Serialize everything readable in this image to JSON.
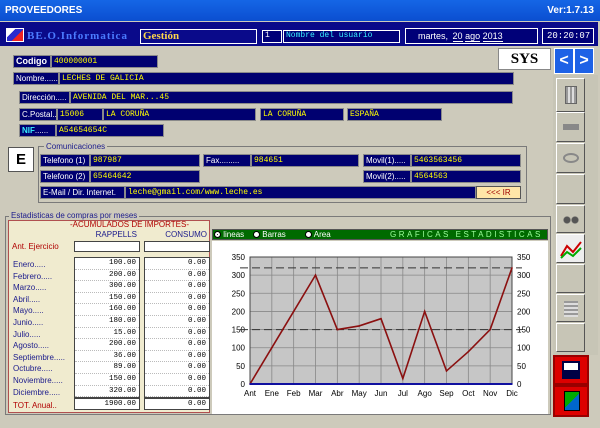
{
  "window": {
    "title": "PROVEEDORES",
    "version": "Ver:1.7.13"
  },
  "topbar": {
    "company": "BE.O.Informatica",
    "module": "Gestión",
    "user_num": "1",
    "user_name": "Nombre del usuario",
    "date_dow": "martes,",
    "date_day": "20",
    "date_mon": "ago",
    "date_year": "2013",
    "time": "20:20:07"
  },
  "buttons": {
    "sys": "SYS",
    "prev": "<",
    "next": ">",
    "e": "E",
    "ir": "<<< IR"
  },
  "form": {
    "codigo_label": "Codigo",
    "codigo": "400000001",
    "nombre_label": "Nombre",
    "nombre": "LECHES DE GALICIA",
    "direccion_label": "Dirección",
    "direccion": "AVENIDA DEL MAR...45",
    "cp_label": "C.Postal",
    "cp": "15006",
    "poblacion": "LA CORUÑA",
    "provincia": "LA CORUÑA",
    "pais": "ESPAÑA",
    "nif_label": "NIF",
    "nif": "A54654654C"
  },
  "comunicaciones": {
    "title": "Comunicaciones",
    "tel1_label": "Telefono (1)",
    "tel1": "987987",
    "fax_label": "Fax",
    "fax": "984651",
    "movil1_label": "Movil(1)",
    "movil1": "5463563456",
    "tel2_label": "Telefono (2)",
    "tel2": "65464642",
    "movil2_label": "Movil(2)",
    "movil2": "4564563",
    "email_label": "E-Mail / Dir. Internet",
    "email": "leche@gmail.com/www.leche.es"
  },
  "stats": {
    "title": "Estadisticas de compras por meses",
    "acum_title": "ACUMULADOS DE IMPORTES",
    "col_rappells": "RAPPELLS",
    "col_consumo": "CONSUMO",
    "ant_label": "Ant. Ejercicio",
    "months": [
      "Enero",
      "Febrero",
      "Marzo",
      "Abril",
      "Mayo",
      "Junio",
      "Julio",
      "Agosto",
      "Septiembre",
      "Octubre",
      "Noviembre",
      "Diciembre"
    ],
    "rappells": [
      "100.00",
      "200.00",
      "300.00",
      "150.00",
      "160.00",
      "180.00",
      "15.00",
      "200.00",
      "36.00",
      "89.00",
      "150.00",
      "320.00"
    ],
    "consumo": [
      "0.00",
      "0.00",
      "0.00",
      "0.00",
      "0.00",
      "0.00",
      "0.00",
      "0.00",
      "0.00",
      "0.00",
      "0.00",
      "0.00"
    ],
    "total_label": "TOT. Anual",
    "total_rappells": "1900.00",
    "total_consumo": "0.00"
  },
  "graph": {
    "opt_lineas": "lineas",
    "opt_barras": "Barras",
    "opt_area": "Area",
    "title": "GRAFICAS ESTADISTICAS",
    "selected": "lineas"
  },
  "chart_data": {
    "type": "line",
    "categories": [
      "Ant",
      "Ene",
      "Feb",
      "Mar",
      "Abr",
      "May",
      "Jun",
      "Jul",
      "Ago",
      "Sep",
      "Oct",
      "Nov",
      "Dic"
    ],
    "series": [
      {
        "values": [
          0,
          100,
          200,
          300,
          150,
          160,
          180,
          15,
          200,
          36,
          89,
          150,
          320
        ],
        "color": "#8b1010"
      },
      {
        "values": [
          0,
          0,
          0,
          0,
          0,
          0,
          0,
          0,
          0,
          0,
          0,
          0,
          0
        ],
        "color": "#1010a0"
      }
    ],
    "ylim": [
      0,
      350
    ],
    "yticks": [
      0,
      50,
      100,
      150,
      200,
      250,
      300,
      350
    ],
    "dashed_refs": [
      320,
      150
    ],
    "grid": true
  }
}
